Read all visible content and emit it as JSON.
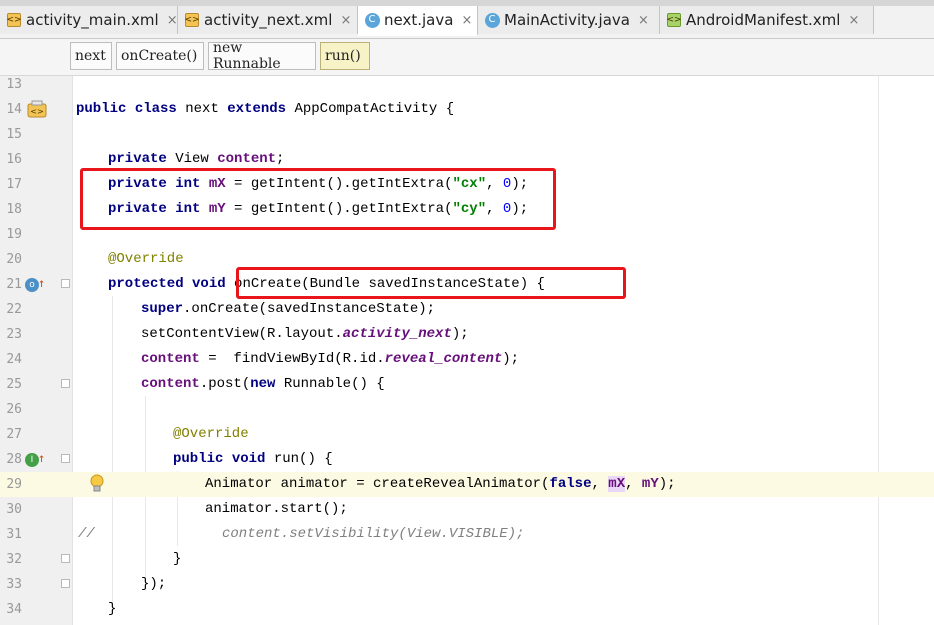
{
  "tabs": [
    {
      "label": "activity_main.xml",
      "icon": "xml-file-icon",
      "active": false
    },
    {
      "label": "activity_next.xml",
      "icon": "xml-file-icon",
      "active": false
    },
    {
      "label": "next.java",
      "icon": "class-file-icon",
      "active": true
    },
    {
      "label": "MainActivity.java",
      "icon": "class-file-icon",
      "active": false
    },
    {
      "label": "AndroidManifest.xml",
      "icon": "manifest-file-icon",
      "active": false
    }
  ],
  "tab_close_glyph": "×",
  "breadcrumbs": [
    "next",
    "onCreate()",
    "new Runnable",
    "run()"
  ],
  "line_numbers": [
    "13",
    "14",
    "15",
    "16",
    "17",
    "18",
    "19",
    "20",
    "21",
    "22",
    "23",
    "24",
    "25",
    "26",
    "27",
    "28",
    "29",
    "30",
    "31",
    "32",
    "33",
    "34"
  ],
  "code": {
    "l14": {
      "public": "public",
      "class": "class",
      "name": " next ",
      "extends": "extends",
      "rest": " AppCompatActivity {"
    },
    "l16": {
      "private": "private",
      "type": " View ",
      "field": "content",
      ";": ";"
    },
    "l17": {
      "private": "private",
      "int": " int ",
      "field": "mX",
      "mid": " = getIntent().getIntExtra(",
      "str": "\"cx\"",
      "sep": ", ",
      "num": "0",
      "end": ");"
    },
    "l18": {
      "private": "private",
      "int": " int ",
      "field": "mY",
      "mid": " = getIntent().getIntExtra(",
      "str": "\"cy\"",
      "sep": ", ",
      "num": "0",
      "end": ");"
    },
    "l20": "@Override",
    "l21": {
      "protected": "protected",
      "void": " void",
      "sig": " onCreate(Bundle savedInstanceState) {"
    },
    "l22": {
      "super": "super",
      "rest": ".onCreate(savedInstanceState);"
    },
    "l23": {
      "pre": "setContentView(R.layout.",
      "field": "activity_next",
      "post": ");"
    },
    "l24": {
      "field": "content",
      "mid": " =  findViewById(R.id.",
      "field2": "reveal_content",
      "post": ");"
    },
    "l25": {
      "field": "content",
      "mid": ".post(",
      "new": "new",
      "post": " Runnable() {"
    },
    "l27": "@Override",
    "l28": {
      "public": "public",
      "void": " void",
      "rest": " run() {"
    },
    "l29": {
      "pre": "Animator animator = createRevealAnimator(",
      "false": "false",
      "sep1": ", ",
      "mx": "mX",
      "sep2": ", ",
      "my": "mY",
      "post": ");"
    },
    "l30": "animator.start();",
    "l31": {
      "slashes": "//",
      "comment": "content.setVisibility(View.VISIBLE);"
    },
    "l32": "}",
    "l33": "});",
    "l34": "}"
  },
  "colors": {
    "keyword": "#000080",
    "field": "#660e7a",
    "string": "#008000",
    "number": "#0000ff",
    "annotation": "#808000",
    "comment": "#808080",
    "highlight_box": "#e8151b"
  }
}
